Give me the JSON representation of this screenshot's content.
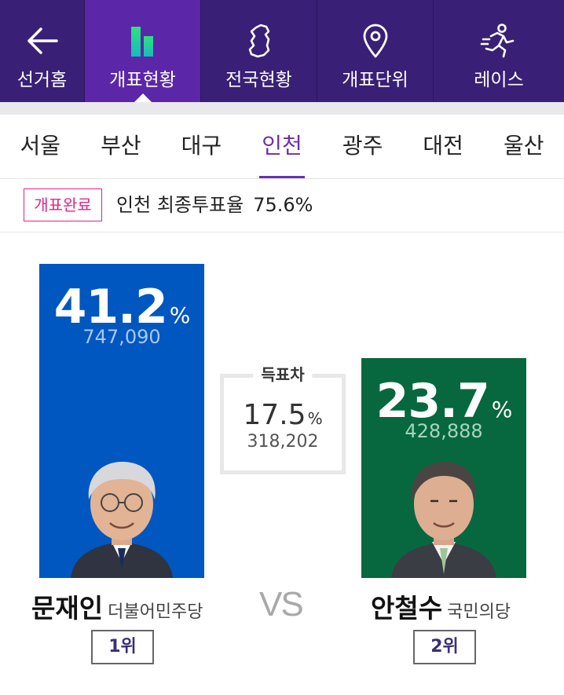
{
  "nav": {
    "items": [
      {
        "label": "선거홈",
        "icon": "back-arrow-icon"
      },
      {
        "label": "개표현황",
        "icon": "bar-chart-icon"
      },
      {
        "label": "전국현황",
        "icon": "korea-map-icon"
      },
      {
        "label": "개표단위",
        "icon": "location-pin-icon"
      },
      {
        "label": "레이스",
        "icon": "runner-icon"
      }
    ],
    "active_index": 1,
    "colors": {
      "background": "#3a1f76",
      "active": "#5b27a8"
    }
  },
  "regions": {
    "tabs": [
      "서울",
      "부산",
      "대구",
      "인천",
      "광주",
      "대전",
      "울산"
    ],
    "active_index": 3,
    "active_color": "#6a2fb3"
  },
  "status": {
    "badge": "개표완료",
    "region": "인천",
    "turnout_label": "최종투표율",
    "turnout_value": "75.6%"
  },
  "candidates": [
    {
      "percent": "41.2",
      "unit": "%",
      "votes": "747,090",
      "name": "문재인",
      "party": "더불어민주당",
      "rank": "1위",
      "color": "#0057c0"
    },
    {
      "percent": "23.7",
      "unit": "%",
      "votes": "428,888",
      "name": "안철수",
      "party": "국민의당",
      "rank": "2위",
      "color": "#07683f"
    }
  ],
  "difference": {
    "label": "득표차",
    "percent": "17.5",
    "unit": "%",
    "votes": "318,202"
  },
  "vs_label": "VS"
}
